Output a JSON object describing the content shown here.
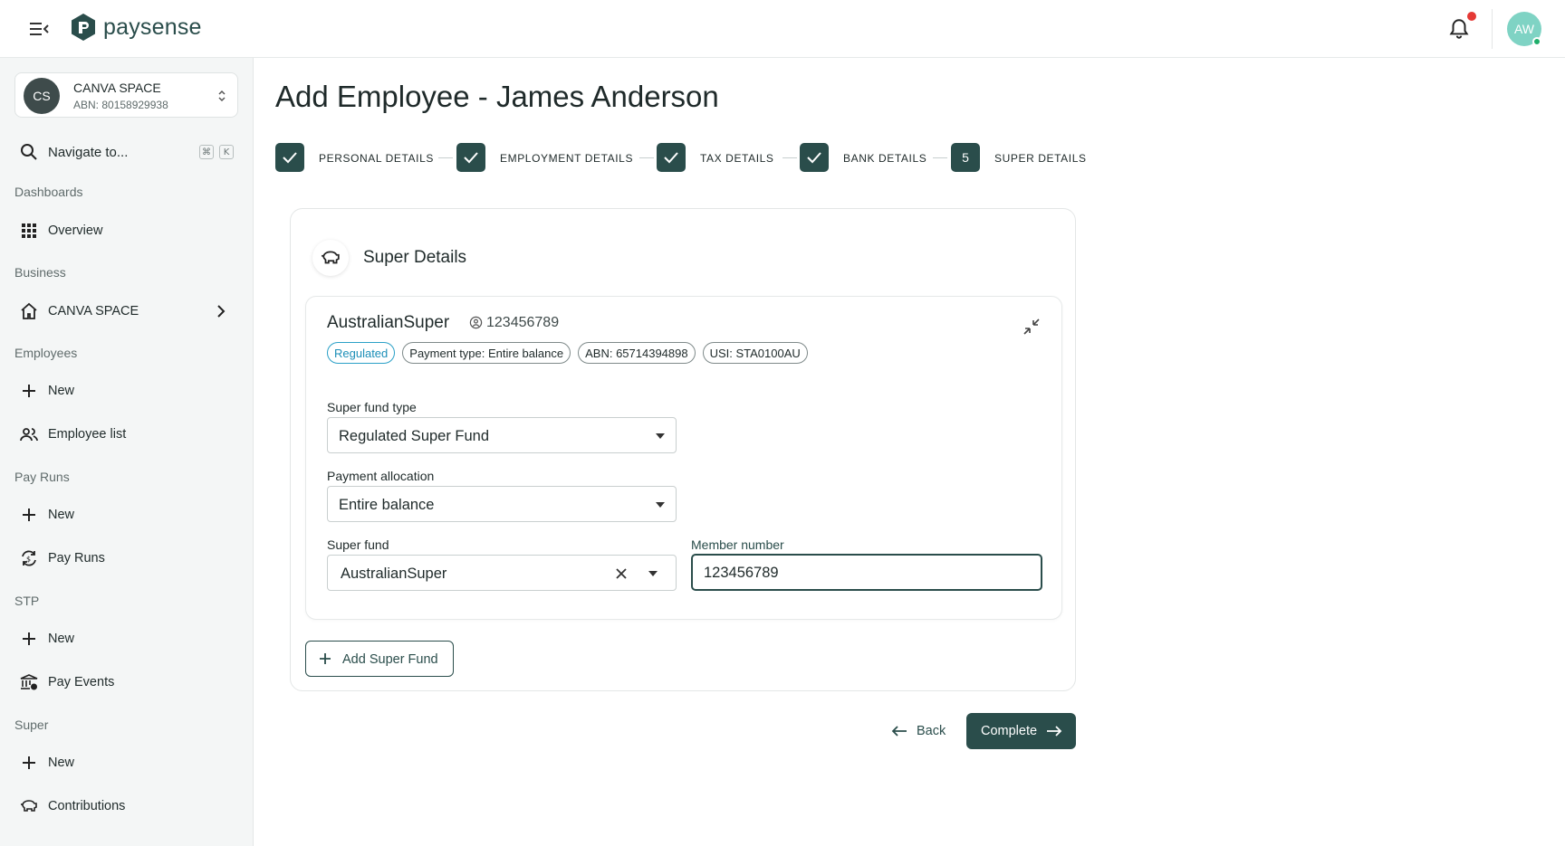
{
  "app": {
    "brand": "paysense"
  },
  "topbar": {
    "avatar_initials": "AW"
  },
  "org": {
    "initials": "CS",
    "name": "CANVA SPACE",
    "abn": "ABN: 80158929938"
  },
  "nav": {
    "search_label": "Navigate to...",
    "shortcut_keys": [
      "⌘",
      "K"
    ],
    "sections": {
      "dashboards": "Dashboards",
      "business": "Business",
      "employees": "Employees",
      "pay_runs": "Pay Runs",
      "stp": "STP",
      "super": "Super"
    },
    "items": {
      "overview": "Overview",
      "canva_space": "CANVA SPACE",
      "employees_new": "New",
      "employee_list": "Employee list",
      "pay_runs_new": "New",
      "pay_runs": "Pay Runs",
      "stp_new": "New",
      "pay_events": "Pay Events",
      "super_new": "New",
      "contributions": "Contributions"
    }
  },
  "page": {
    "title": "Add Employee - James Anderson"
  },
  "stepper": {
    "steps": [
      {
        "label": "PERSONAL DETAILS",
        "state": "complete"
      },
      {
        "label": "EMPLOYMENT DETAILS",
        "state": "complete"
      },
      {
        "label": "TAX DETAILS",
        "state": "complete"
      },
      {
        "label": "BANK DETAILS",
        "state": "complete"
      },
      {
        "label": "SUPER DETAILS",
        "state": "current",
        "number": "5"
      }
    ]
  },
  "card": {
    "title": "Super Details"
  },
  "fund": {
    "name": "AustralianSuper",
    "member_number": "123456789",
    "chips": {
      "regulated": "Regulated",
      "payment_type": "Payment type: Entire balance",
      "abn": "ABN: 65714394898",
      "usi": "USI: STA0100AU"
    },
    "fields": {
      "fund_type_label": "Super fund type",
      "fund_type_value": "Regulated Super Fund",
      "allocation_label": "Payment allocation",
      "allocation_value": "Entire balance",
      "super_fund_label": "Super fund",
      "super_fund_value": "AustralianSuper",
      "member_label": "Member number",
      "member_value": "123456789"
    }
  },
  "actions": {
    "add_fund": "Add Super Fund",
    "back": "Back",
    "complete": "Complete"
  },
  "colors": {
    "primary": "#2a4d4b",
    "regulated": "#1d8fb8",
    "notification": "#e53935",
    "avatar": "#7fd3c4",
    "online": "#1fae6a"
  }
}
